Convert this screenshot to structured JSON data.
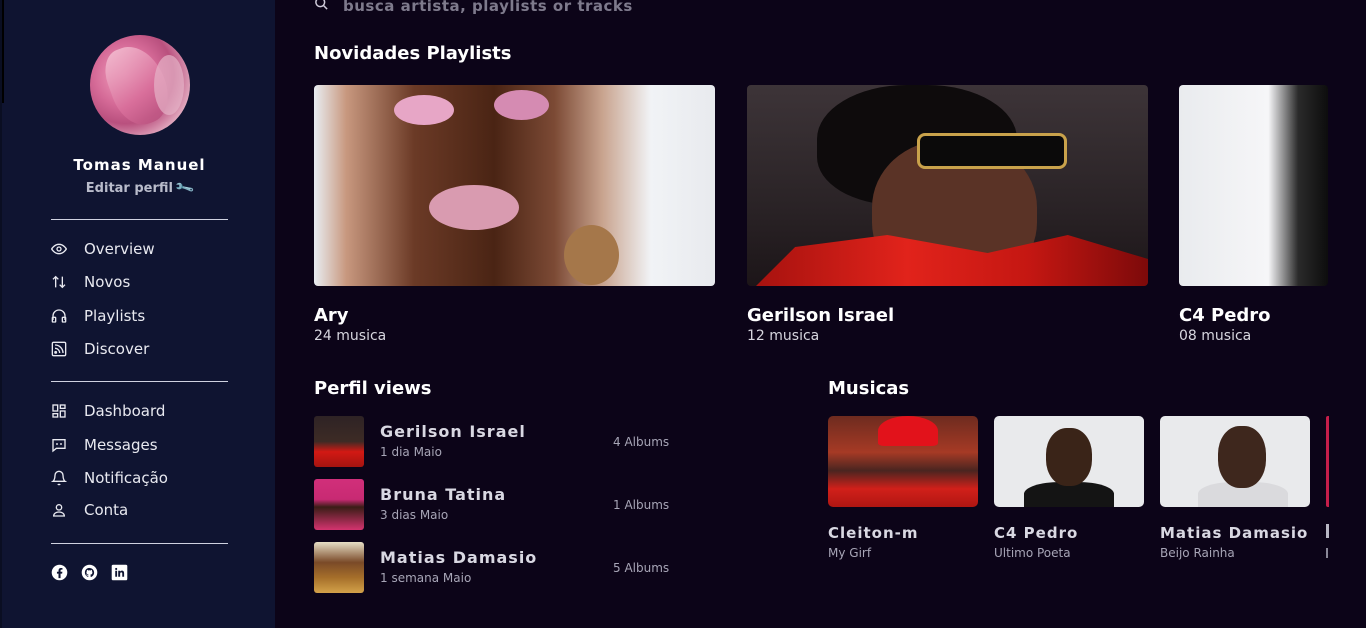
{
  "sidebar": {
    "user_name": "Tomas Manuel",
    "edit_profile": "Editar perfil",
    "nav_primary": [
      {
        "label": "Overview",
        "icon": "eye-icon"
      },
      {
        "label": "Novos",
        "icon": "sort-arrows-icon"
      },
      {
        "label": "Playlists",
        "icon": "headphones-icon"
      },
      {
        "label": "Discover",
        "icon": "rss-icon"
      }
    ],
    "nav_secondary": [
      {
        "label": "Dashboard",
        "icon": "dashboard-icon"
      },
      {
        "label": "Messages",
        "icon": "message-icon"
      },
      {
        "label": "Notificação",
        "icon": "bell-icon"
      },
      {
        "label": "Conta",
        "icon": "user-icon"
      }
    ],
    "social": [
      "facebook-icon",
      "github-icon",
      "linkedin-icon"
    ]
  },
  "search": {
    "placeholder": "busca artista, playlists or tracks"
  },
  "playlists": {
    "title": "Novidades Playlists",
    "items": [
      {
        "name": "Ary",
        "count": "24 musica"
      },
      {
        "name": "Gerilson Israel",
        "count": "12 musica"
      },
      {
        "name": "C4 Pedro",
        "count": "08 musica"
      }
    ]
  },
  "profile_views": {
    "title": "Perfil views",
    "items": [
      {
        "name": "Gerilson Israel",
        "date": "1 dia Maio",
        "albums": "4 Albums"
      },
      {
        "name": "Bruna Tatina",
        "date": "3 dias Maio",
        "albums": "1 Albums"
      },
      {
        "name": "Matias Damasio",
        "date": "1 semana Maio",
        "albums": "5 Albums"
      }
    ]
  },
  "musicas": {
    "title": "Musicas",
    "items": [
      {
        "artist": "Cleiton-m",
        "track": "My Girf"
      },
      {
        "artist": "C4 Pedro",
        "track": "Ultimo Poeta"
      },
      {
        "artist": "Matias Damasio",
        "track": "Beijo Rainha"
      }
    ]
  },
  "colors": {
    "sidebar_bg": "#0f1431",
    "main_bg": "#0c0418",
    "accent": "#c61e4a"
  }
}
